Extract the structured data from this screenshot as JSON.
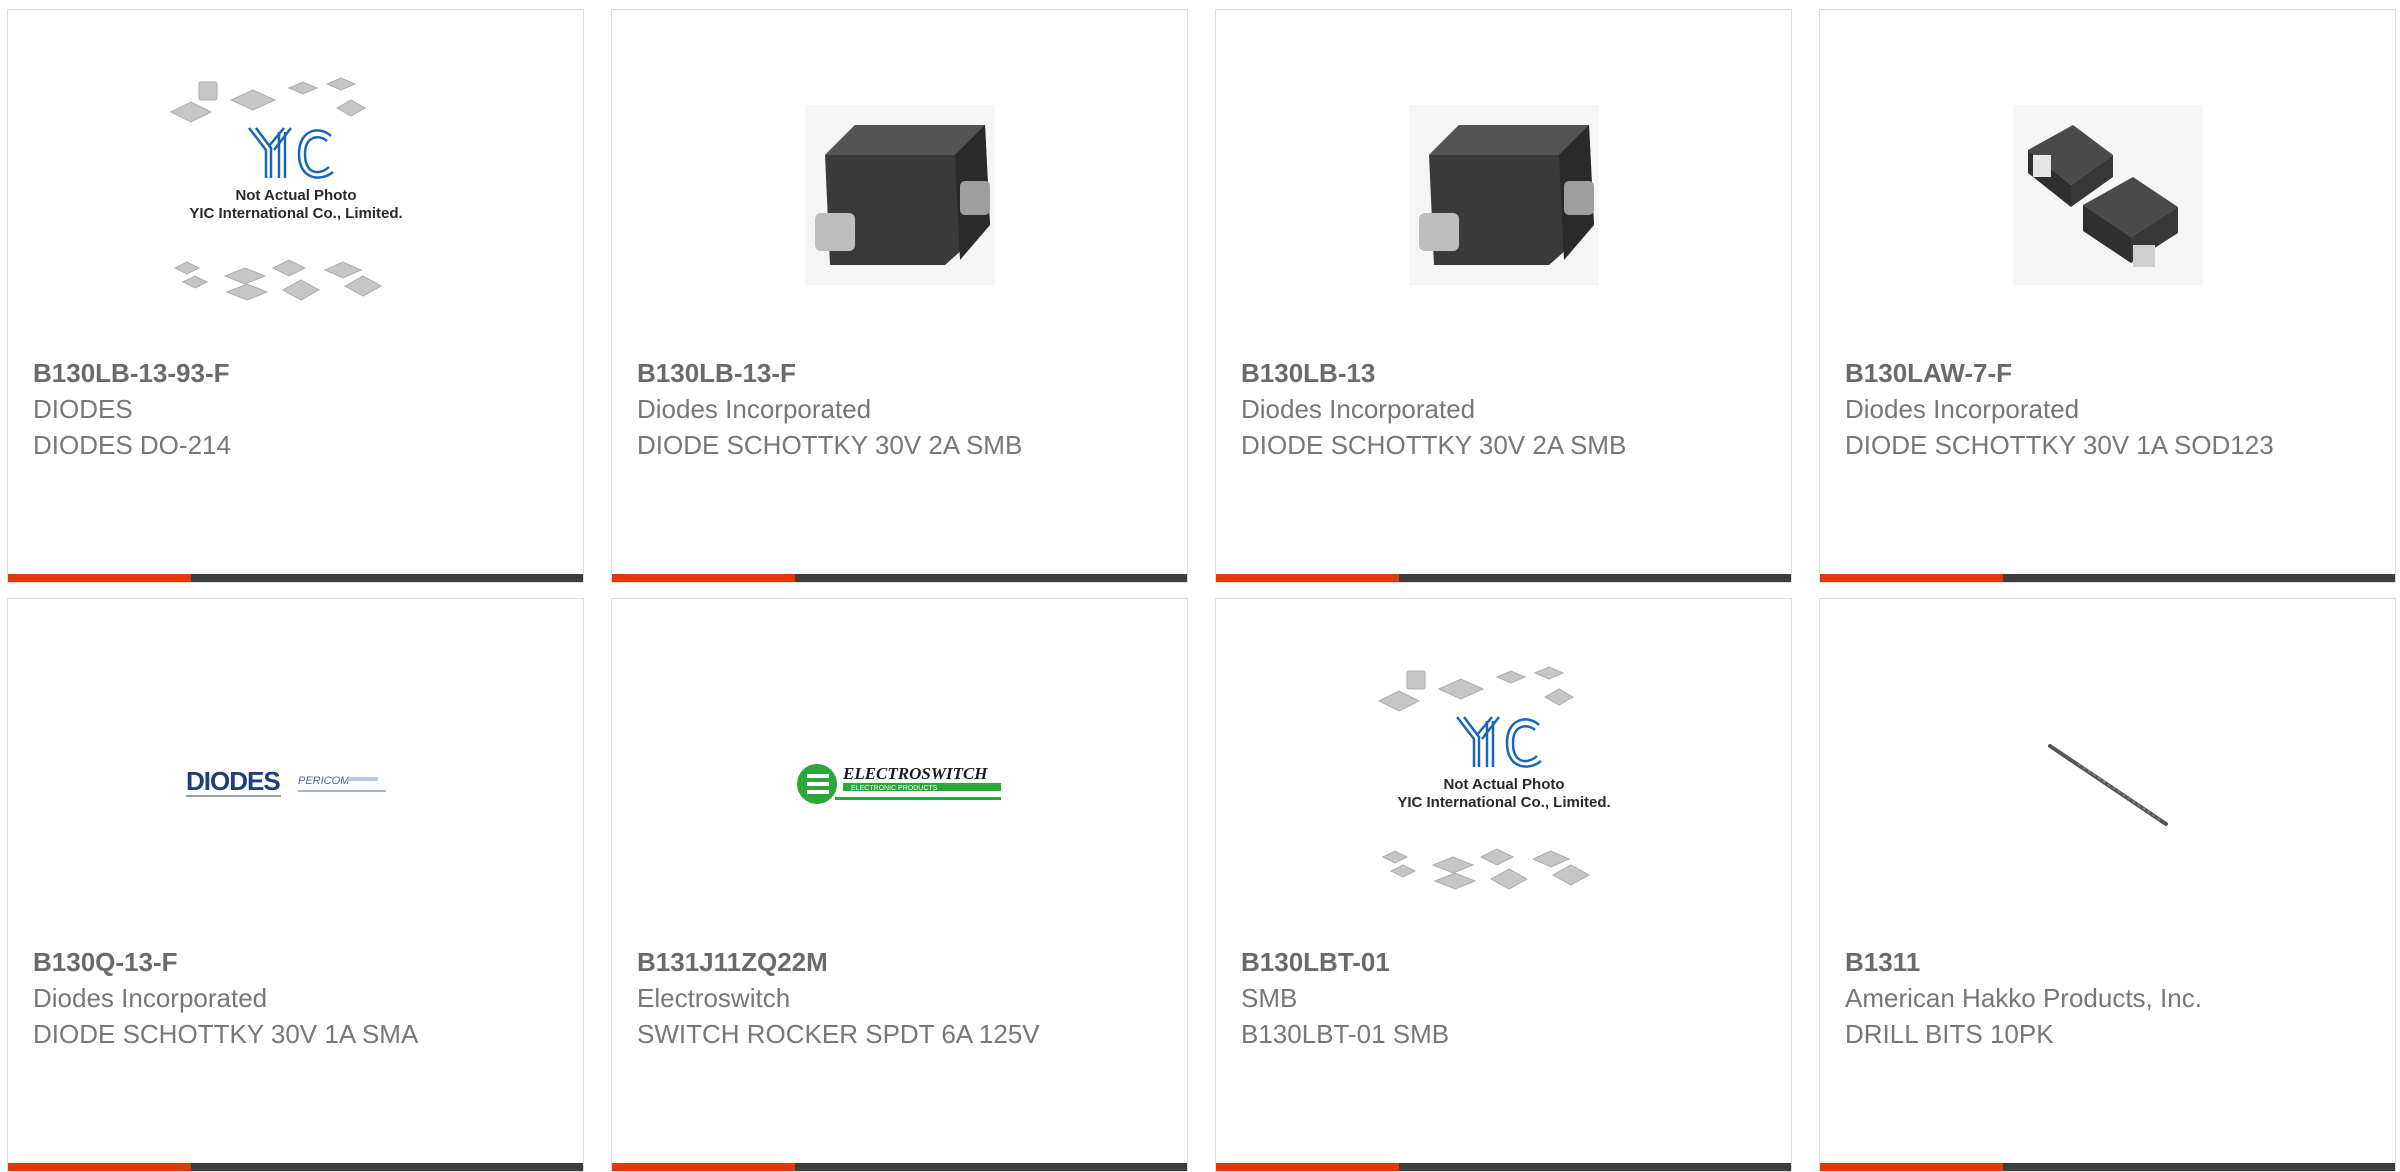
{
  "colors": {
    "accent": "#e03a08",
    "bar": "#3d3d3d",
    "border": "#dcdcdc",
    "text": "#777777"
  },
  "products": [
    {
      "part": "B130LB-13-93-F",
      "manufacturer": "DIODES",
      "description": "DIODES DO-214",
      "image": "yic-placeholder",
      "placeholder": {
        "line1": "Not Actual Photo",
        "line2": "YIC International Co., Limited.",
        "logo": "YIC"
      }
    },
    {
      "part": "B130LB-13-F",
      "manufacturer": "Diodes Incorporated",
      "description": "DIODE SCHOTTKY 30V 2A SMB",
      "image": "smb-package"
    },
    {
      "part": "B130LB-13",
      "manufacturer": "Diodes Incorporated",
      "description": "DIODE SCHOTTKY 30V 2A SMB",
      "image": "smb-package"
    },
    {
      "part": "B130LAW-7-F",
      "manufacturer": "Diodes Incorporated",
      "description": "DIODE SCHOTTKY 30V 1A SOD123",
      "image": "sod123-package"
    },
    {
      "part": "B130Q-13-F",
      "manufacturer": "Diodes Incorporated",
      "description": "DIODE SCHOTTKY 30V 1A SMA",
      "image": "diodes-logo",
      "logo": {
        "main": "DIODES",
        "second": "PERICOM"
      }
    },
    {
      "part": "B131J11ZQ22M",
      "manufacturer": "Electroswitch",
      "description": "SWITCH ROCKER SPDT 6A 125V",
      "image": "electroswitch-logo",
      "logo": {
        "main": "ELECTROSWITCH",
        "sub": "ELECTRONIC PRODUCTS"
      }
    },
    {
      "part": "B130LBT-01",
      "manufacturer": "SMB",
      "description": "B130LBT-01 SMB",
      "image": "yic-placeholder",
      "placeholder": {
        "line1": "Not Actual Photo",
        "line2": "YIC International Co., Limited.",
        "logo": "YIC"
      }
    },
    {
      "part": "B1311",
      "manufacturer": "American Hakko Products, Inc.",
      "description": "DRILL BITS 10PK",
      "image": "drill-bit"
    }
  ]
}
